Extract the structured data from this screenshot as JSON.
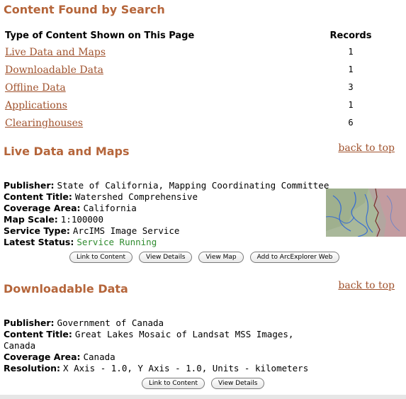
{
  "page_title": "Content Found by Search",
  "summary": {
    "col_type": "Type of Content Shown on This Page",
    "col_records": "Records",
    "rows": [
      {
        "label": "Live Data and Maps",
        "count": "1"
      },
      {
        "label": "Downloadable Data",
        "count": "1"
      },
      {
        "label": "Offline Data",
        "count": "3"
      },
      {
        "label": "Applications",
        "count": "1"
      },
      {
        "label": "Clearinghouses",
        "count": "6"
      }
    ]
  },
  "back_to_top": "back to top",
  "live": {
    "heading": "Live Data and Maps",
    "publisher_label": "Publisher:",
    "publisher": "State of California, Mapping Coordinating Committee",
    "content_title_label": "Content Title:",
    "content_title": "Watershed Comprehensive",
    "coverage_label": "Coverage Area:",
    "coverage": "California",
    "scale_label": "Map Scale:",
    "scale": "1:100000",
    "service_type_label": "Service Type:",
    "service_type": "ArcIMS Image Service",
    "status_label": "Latest Status:",
    "status": "Service Running",
    "status_color": "#2e8b2e",
    "buttons": {
      "link": "Link to Content",
      "details": "View Details",
      "map": "View Map",
      "arcexplorer": "Add to ArcExplorer Web"
    }
  },
  "download": {
    "heading": "Downloadable Data",
    "publisher_label": "Publisher:",
    "publisher": "Government of Canada",
    "content_title_label": "Content Title:",
    "content_title": "Great Lakes Mosaic of Landsat MSS Images, Canada",
    "coverage_label": "Coverage Area:",
    "coverage": "Canada",
    "resolution_label": "Resolution:",
    "resolution": "X Axis - 1.0, Y Axis - 1.0, Units - kilometers",
    "buttons": {
      "link": "Link to Content",
      "details": "View Details"
    }
  },
  "colors": {
    "heading": "#b5653a",
    "link": "#a0522d"
  }
}
